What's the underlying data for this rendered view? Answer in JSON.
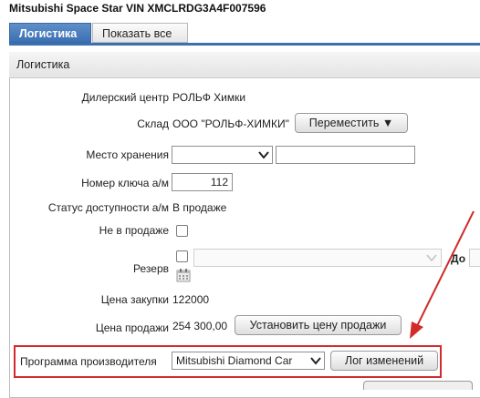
{
  "page": {
    "title": "Mitsubishi Space Star VIN XMCLRDG3A4F007596"
  },
  "tabs": [
    {
      "label": "Логистика",
      "active": true
    },
    {
      "label": "Показать все",
      "active": false
    }
  ],
  "panel": {
    "title": "Логистика"
  },
  "form": {
    "dealer": {
      "label": "Дилерский центр",
      "value": "РОЛЬФ Химки"
    },
    "warehouse": {
      "label": "Склад",
      "value": "ООО \"РОЛЬФ-ХИМКИ\"",
      "move_button": "Переместить ▼"
    },
    "storage": {
      "label": "Место хранения",
      "select_value": "",
      "text_value": ""
    },
    "key_number": {
      "label": "Номер ключа а/м",
      "value": "112"
    },
    "availability": {
      "label": "Статус доступности а/м",
      "value": "В продаже"
    },
    "not_for_sale": {
      "label": "Не в продаже",
      "checked": false
    },
    "reserve": {
      "label": "Резерв",
      "checked": false,
      "until_label": "До",
      "select_value": ""
    },
    "purchase_price": {
      "label": "Цена закупки",
      "value": "122000"
    },
    "sale_price": {
      "label": "Цена продажи",
      "value": "254 300,00",
      "set_button": "Установить цену продажи"
    },
    "manufacturer_program": {
      "label": "Программа производителя",
      "value": "Mitsubishi Diamond Car",
      "log_button": "Лог изменений"
    }
  },
  "colors": {
    "tab_active": "#3c70b2",
    "highlight": "#d12b2b",
    "arrow": "#d12b2b"
  }
}
